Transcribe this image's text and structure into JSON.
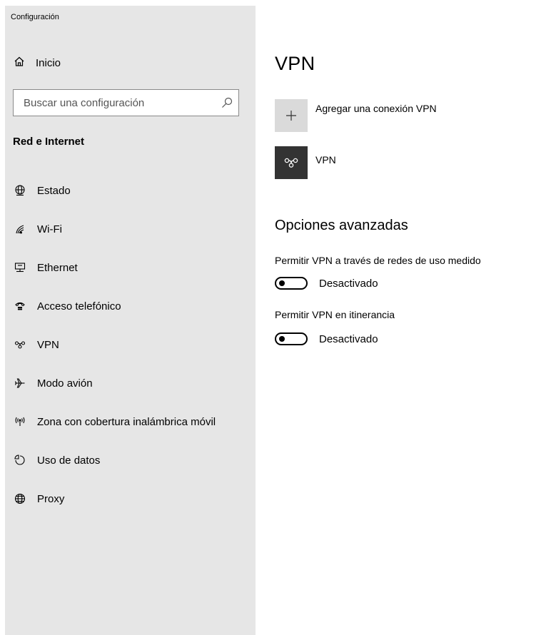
{
  "app": {
    "title": "Configuración"
  },
  "sidebar": {
    "home": {
      "label": "Inicio",
      "icon": "home-icon"
    },
    "search": {
      "placeholder": "Buscar una configuración",
      "value": "",
      "icon": "search-icon"
    },
    "section_title": "Red e Internet",
    "items": [
      {
        "label": "Estado",
        "icon": "globe-status-icon"
      },
      {
        "label": "Wi-Fi",
        "icon": "wifi-icon"
      },
      {
        "label": "Ethernet",
        "icon": "ethernet-icon"
      },
      {
        "label": "Acceso telefónico",
        "icon": "dialup-phone-icon"
      },
      {
        "label": "VPN",
        "icon": "vpn-icon"
      },
      {
        "label": "Modo avión",
        "icon": "airplane-icon"
      },
      {
        "label": "Zona con cobertura inalámbrica móvil",
        "icon": "hotspot-icon"
      },
      {
        "label": "Uso de datos",
        "icon": "data-usage-icon"
      },
      {
        "label": "Proxy",
        "icon": "globe-icon"
      }
    ]
  },
  "main": {
    "title": "VPN",
    "add_connection": {
      "label": "Agregar una conexión VPN",
      "icon": "plus-icon"
    },
    "connection": {
      "label": "VPN",
      "icon": "vpn-icon"
    },
    "advanced": {
      "title": "Opciones avanzadas",
      "settings": [
        {
          "label": "Permitir VPN a través de redes de uso medido",
          "state": "Desactivado",
          "on": false
        },
        {
          "label": "Permitir VPN en itinerancia",
          "state": "Desactivado",
          "on": false
        }
      ]
    }
  },
  "colors": {
    "sidebar_bg": "#e6e6e6",
    "add_tile_bg": "#dadada",
    "vpn_tile_bg": "#333333"
  }
}
